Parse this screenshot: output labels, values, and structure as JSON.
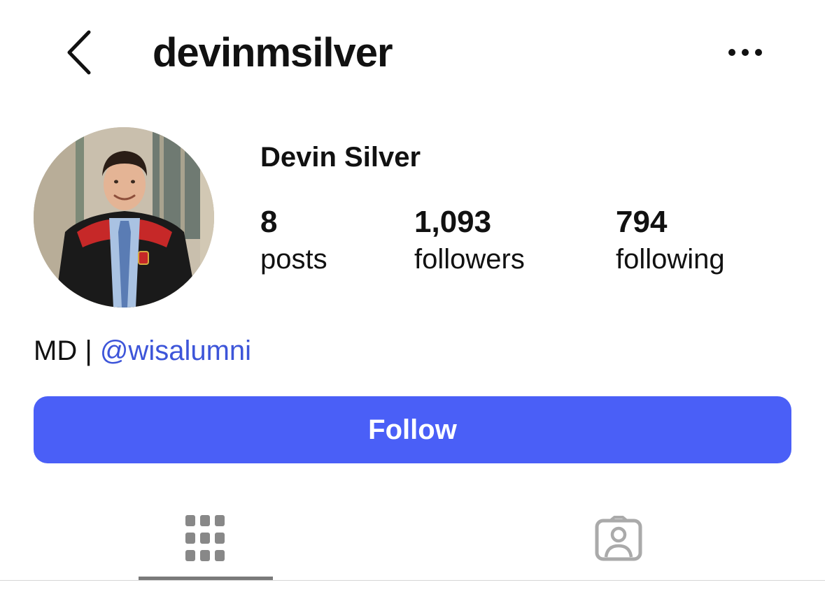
{
  "header": {
    "username": "devinmsilver",
    "back_icon": "chevron-left-icon",
    "more_icon": "more-horizontal-icon"
  },
  "profile": {
    "display_name": "Devin Silver",
    "avatar_description": "profile photo"
  },
  "stats": {
    "posts": {
      "value": "8",
      "label": "posts"
    },
    "followers": {
      "value": "1,093",
      "label": "followers"
    },
    "following": {
      "value": "794",
      "label": "following"
    }
  },
  "bio": {
    "text": "MD | ",
    "mention": "@wisalumni"
  },
  "actions": {
    "follow_label": "Follow"
  },
  "tabs": [
    {
      "icon": "grid-icon",
      "active": true
    },
    {
      "icon": "tagged-person-icon",
      "active": false
    }
  ],
  "colors": {
    "accent": "#4a5ff7",
    "mention": "#3d55d9",
    "icon_gray": "#888888",
    "text": "#111111"
  }
}
